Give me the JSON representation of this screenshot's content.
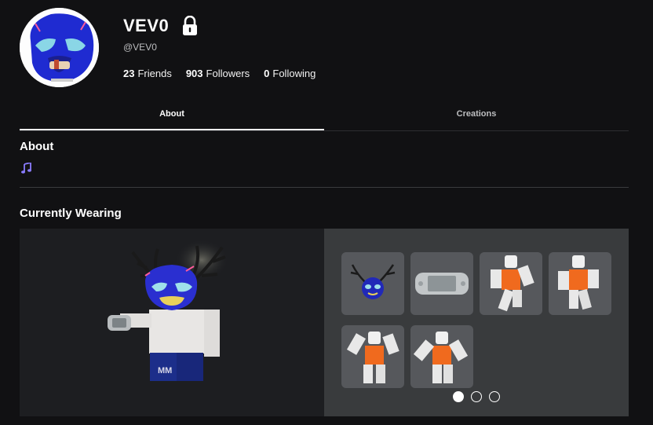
{
  "profile": {
    "display_name": "VEV0",
    "username": "@VEV0",
    "stats": [
      {
        "count": "23",
        "label": "Friends"
      },
      {
        "count": "903",
        "label": "Followers"
      },
      {
        "count": "0",
        "label": "Following"
      }
    ]
  },
  "tabs": [
    {
      "label": "About",
      "active": true
    },
    {
      "label": "Creations",
      "active": false
    }
  ],
  "about": {
    "title": "About",
    "icon": "music-note-icon"
  },
  "wearing": {
    "title": "Currently Wearing",
    "items": [
      {
        "name": "antlers-mask-accessory"
      },
      {
        "name": "handheld-console-accessory"
      },
      {
        "name": "animation-pose-1"
      },
      {
        "name": "animation-pose-2"
      },
      {
        "name": "animation-pose-3"
      },
      {
        "name": "animation-pose-4"
      }
    ],
    "pages": 3,
    "current_page": 1
  },
  "colors": {
    "background": "#111113",
    "panel": "#393b3d",
    "item_tile": "#56585c",
    "accent_music": "#8a7cff"
  }
}
